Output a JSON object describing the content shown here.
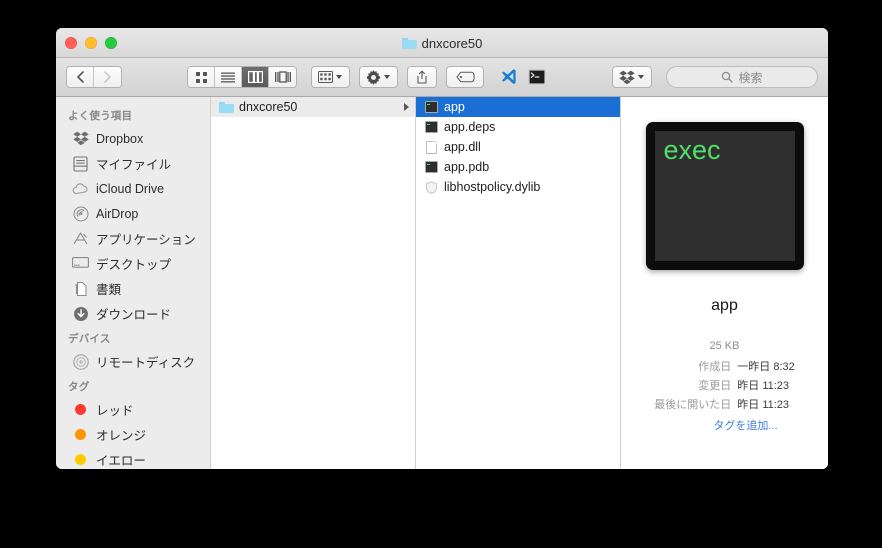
{
  "window": {
    "title": "dnxcore50",
    "title_icon": "folder-icon",
    "traffic_lights": [
      {
        "name": "close-button",
        "color": "#ff5f57"
      },
      {
        "name": "minimize-button",
        "color": "#febc2e"
      },
      {
        "name": "maximize-button",
        "color": "#28c840"
      }
    ]
  },
  "toolbar": {
    "back_label": "‹",
    "forward_label": "›",
    "view_buttons": [
      {
        "name": "icon-view-button",
        "icon": "grid-icon",
        "active": false
      },
      {
        "name": "list-view-button",
        "icon": "list-icon",
        "active": false
      },
      {
        "name": "column-view-button",
        "icon": "columns-icon",
        "active": true
      },
      {
        "name": "coverflow-view-button",
        "icon": "coverflow-icon",
        "active": false
      }
    ],
    "arrange_button": {
      "name": "arrange-button",
      "icon": "arrange-grid-icon"
    },
    "action_button": {
      "name": "action-button",
      "icon": "gear-icon"
    },
    "share_button": {
      "name": "share-button",
      "icon": "share-icon"
    },
    "tag_button": {
      "name": "tag-button",
      "icon": "tag-icon"
    },
    "vscode_button": {
      "name": "vscode-button",
      "icon": "vscode-icon"
    },
    "terminal_button": {
      "name": "terminal-button",
      "icon": "terminal-icon"
    },
    "dropbox_button": {
      "name": "dropbox-button",
      "icon": "dropbox-icon"
    },
    "search": {
      "placeholder": "検索",
      "value": "",
      "icon": "search-icon"
    }
  },
  "sidebar": {
    "sections": [
      {
        "header": "よく使う項目",
        "items": [
          {
            "label": "Dropbox",
            "icon": "dropbox-icon"
          },
          {
            "label": "マイファイル",
            "icon": "myfiles-icon"
          },
          {
            "label": "iCloud Drive",
            "icon": "icloud-icon"
          },
          {
            "label": "AirDrop",
            "icon": "airdrop-icon"
          },
          {
            "label": "アプリケーション",
            "icon": "applications-icon"
          },
          {
            "label": "デスクトップ",
            "icon": "desktop-icon"
          },
          {
            "label": "書類",
            "icon": "documents-icon"
          },
          {
            "label": "ダウンロード",
            "icon": "downloads-icon"
          }
        ]
      },
      {
        "header": "デバイス",
        "items": [
          {
            "label": "リモートディスク",
            "icon": "remote-disc-icon"
          }
        ]
      },
      {
        "header": "タグ",
        "items": [
          {
            "label": "レッド",
            "icon": "tag-dot-icon",
            "color": "#ff3b30"
          },
          {
            "label": "オレンジ",
            "icon": "tag-dot-icon",
            "color": "#ff9500"
          },
          {
            "label": "イエロー",
            "icon": "tag-dot-icon",
            "color": "#ffcc00"
          }
        ]
      }
    ]
  },
  "columns": {
    "column1": [
      {
        "label": "dnxcore50",
        "icon": "folder-icon",
        "has_disclosure": true,
        "state": "grayed"
      }
    ],
    "column2": [
      {
        "label": "app",
        "icon": "exec-icon",
        "state": "selected"
      },
      {
        "label": "app.deps",
        "icon": "exec-icon",
        "state": "normal"
      },
      {
        "label": "app.dll",
        "icon": "document-icon",
        "state": "normal"
      },
      {
        "label": "app.pdb",
        "icon": "exec-icon",
        "state": "normal"
      },
      {
        "label": "libhostpolicy.dylib",
        "icon": "dylib-icon",
        "state": "normal"
      }
    ]
  },
  "preview": {
    "icon_name": "exec-icon-large",
    "icon_text": "exec",
    "file_name": "app",
    "size": "25 KB",
    "metadata": [
      {
        "key": "作成日",
        "value": "一昨日 8:32"
      },
      {
        "key": "変更日",
        "value": "昨日 11:23"
      },
      {
        "key": "最後に開いた日",
        "value": "昨日 11:23"
      }
    ],
    "add_tag_label": "タグを追加..."
  },
  "colors": {
    "selection_blue": "#1a6fd4",
    "link_blue": "#3b7ddd",
    "exec_green": "#4ee068"
  }
}
